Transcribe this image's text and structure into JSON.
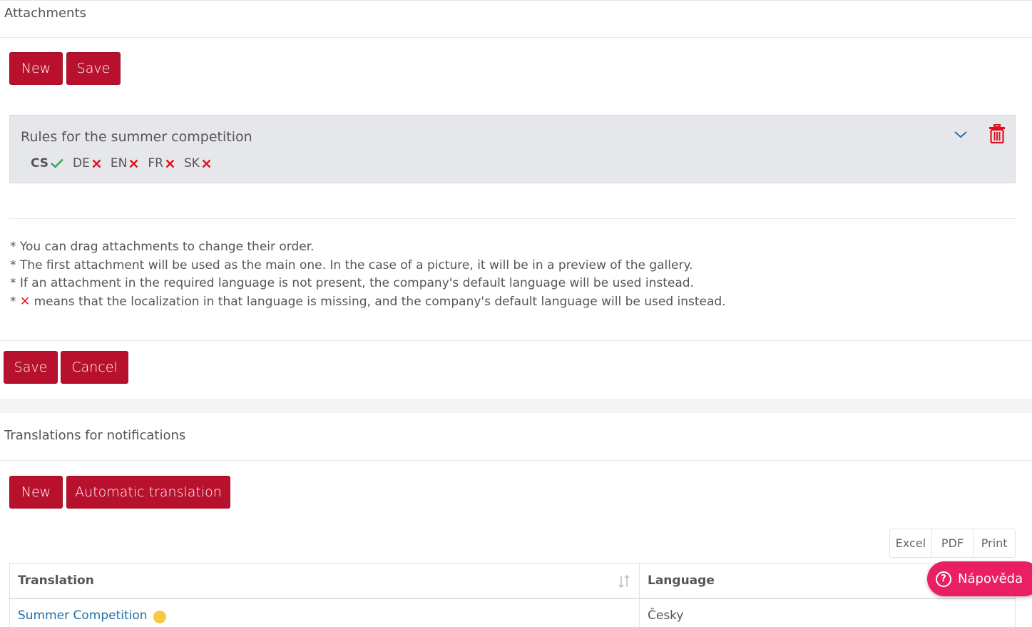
{
  "attachments": {
    "header": "Attachments",
    "new_label": "New",
    "save_label": "Save",
    "item": {
      "title": "Rules for the summer competition",
      "languages": [
        {
          "code": "CS",
          "status": "present"
        },
        {
          "code": "DE",
          "status": "missing"
        },
        {
          "code": "EN",
          "status": "missing"
        },
        {
          "code": "FR",
          "status": "missing"
        },
        {
          "code": "SK",
          "status": "missing"
        }
      ]
    },
    "notes": [
      "* You can drag attachments to change their order.",
      "* The first attachment will be used as the main one. In the case of a picture, it will be in a preview of the gallery.",
      "* If an attachment in the required language is not present, the company's default language will be used instead."
    ],
    "note_x_prefix": "*",
    "note_x_mark": "✕",
    "note_x_text": "means that the localization in that language is missing, and the company's default language will be used instead."
  },
  "form_actions": {
    "save_label": "Save",
    "cancel_label": "Cancel"
  },
  "translations": {
    "header": "Translations for notifications",
    "new_label": "New",
    "auto_label": "Automatic translation",
    "export": {
      "excel": "Excel",
      "pdf": "PDF",
      "print": "Print"
    },
    "columns": {
      "translation": "Translation",
      "language": "Language"
    },
    "rows": [
      {
        "translation": "Summer Competition",
        "language": "Česky"
      }
    ]
  },
  "help": {
    "label": "Nápověda"
  },
  "colors": {
    "primary": "#b8112e",
    "help": "#e91e63",
    "ok": "#2fa84f",
    "missing": "#dd1122",
    "link": "#1f6fa6"
  }
}
